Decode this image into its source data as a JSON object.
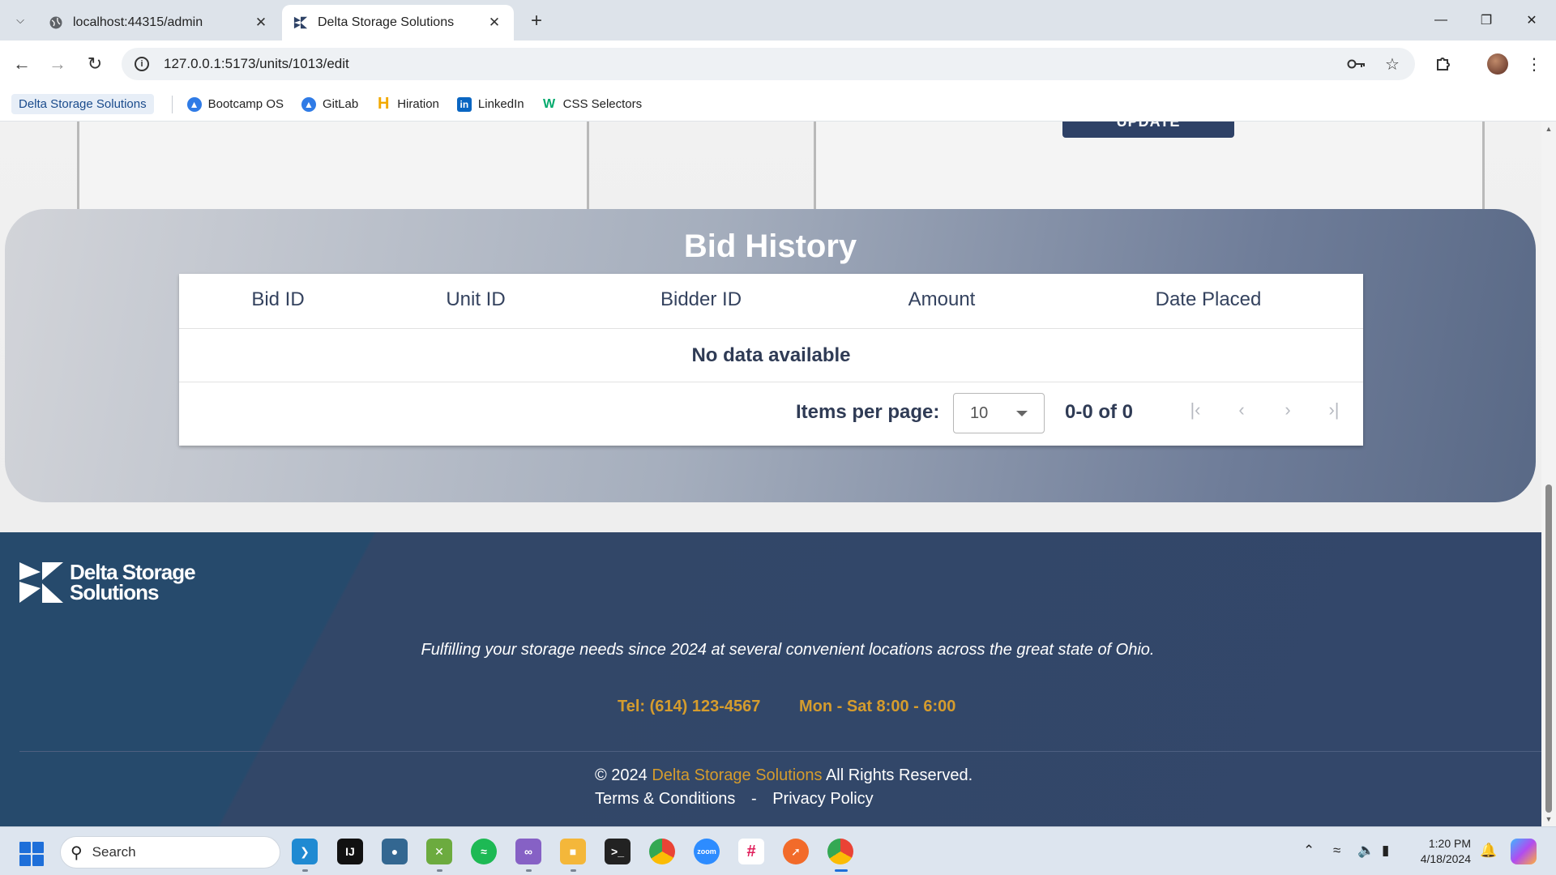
{
  "browser": {
    "tabs": [
      {
        "title": "localhost:44315/admin",
        "active": false
      },
      {
        "title": "Delta Storage Solutions",
        "active": true
      }
    ],
    "url": "127.0.0.1:5173/units/1013/edit",
    "bookmarks": {
      "current": "Delta Storage Solutions",
      "items": [
        {
          "label": "Bootcamp OS",
          "icon": "atlassian-icon"
        },
        {
          "label": "GitLab",
          "icon": "atlassian-icon"
        },
        {
          "label": "Hiration",
          "icon": "hiration-icon"
        },
        {
          "label": "LinkedIn",
          "icon": "linkedin-icon"
        },
        {
          "label": "CSS Selectors",
          "icon": "w3-icon"
        }
      ]
    }
  },
  "page": {
    "update_button": "UPDATE",
    "bid_history": {
      "title": "Bid History",
      "columns": [
        "Bid ID",
        "Unit ID",
        "Bidder ID",
        "Amount",
        "Date Placed"
      ],
      "rows": [],
      "empty_message": "No data available",
      "items_per_page_label": "Items per page:",
      "items_per_page": "10",
      "range": "0-0 of 0"
    },
    "footer": {
      "logo_line1": "Delta Storage",
      "logo_line2": "Solutions",
      "tagline": "Fulfilling your storage needs since 2024 at several convenient locations across the great state of Ohio.",
      "phone": "Tel: (614) 123-4567",
      "hours": "Mon - Sat 8:00 - 6:00",
      "copyright_prefix": "© 2024",
      "copyright_brand": "Delta Storage Solutions",
      "copyright_suffix": "All Rights Reserved.",
      "terms": "Terms & Conditions",
      "separator": "-",
      "privacy": "Privacy Policy"
    },
    "colors": {
      "accent_gold": "#d59c2d",
      "navy": "#2e4266"
    }
  },
  "taskbar": {
    "search_placeholder": "Search",
    "time": "1:20 PM",
    "date": "4/18/2024"
  }
}
